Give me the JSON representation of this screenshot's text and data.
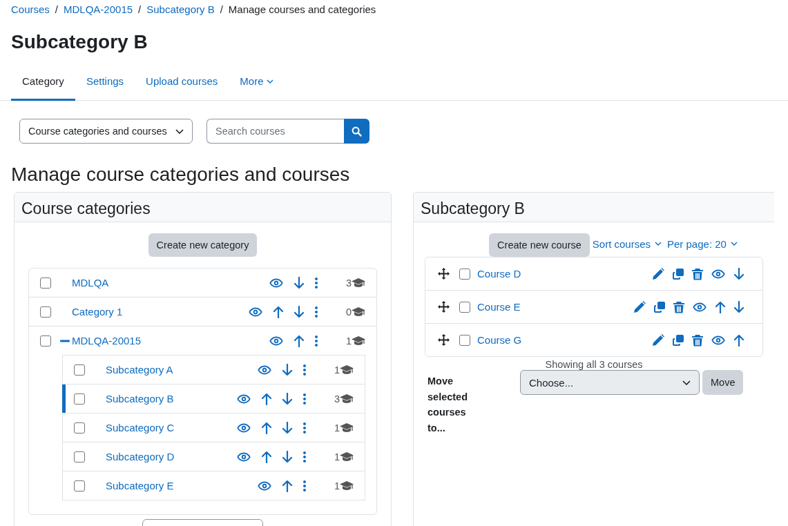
{
  "breadcrumb": [
    {
      "kind": "link",
      "label": "Courses"
    },
    {
      "kind": "separator",
      "label": "/"
    },
    {
      "kind": "link",
      "label": "MDLQA-20015"
    },
    {
      "kind": "separator",
      "label": "/"
    },
    {
      "kind": "link",
      "label": "Subcategory B"
    },
    {
      "kind": "separator",
      "label": "/"
    },
    {
      "kind": "current",
      "label": "Manage courses and categories"
    }
  ],
  "page_title": "Subcategory B",
  "tabs": [
    {
      "label": "Category",
      "selected": true
    },
    {
      "label": "Settings",
      "selected": false
    },
    {
      "label": "Upload courses",
      "selected": false
    },
    {
      "label": "More",
      "selected": false,
      "dropdown": true
    }
  ],
  "view_select": {
    "value": "Course categories and courses"
  },
  "search": {
    "placeholder": "Search courses"
  },
  "heading": "Manage course categories and courses",
  "categories_panel": {
    "title": "Course categories",
    "create_button": "Create new category",
    "categories": [
      {
        "name": "MDLQA",
        "count": "3",
        "checked": false,
        "selected": false,
        "actions": [
          {
            "kind": "eye"
          },
          {
            "kind": "down"
          },
          {
            "kind": "menu"
          }
        ]
      },
      {
        "name": "Category 1",
        "count": "0",
        "checked": false,
        "selected": false,
        "actions": [
          {
            "kind": "eye"
          },
          {
            "kind": "up"
          },
          {
            "kind": "down"
          },
          {
            "kind": "menu"
          }
        ]
      },
      {
        "name": "MDLQA-20015",
        "count": "1",
        "checked": false,
        "selected": false,
        "expanded": true,
        "actions": [
          {
            "kind": "eye"
          },
          {
            "kind": "up"
          },
          {
            "kind": "menu"
          }
        ],
        "children": [
          {
            "name": "Subcategory A",
            "count": "1",
            "checked": false,
            "selected": false,
            "actions": [
              {
                "kind": "eye"
              },
              {
                "kind": "down"
              },
              {
                "kind": "menu"
              }
            ]
          },
          {
            "name": "Subcategory B",
            "count": "3",
            "checked": false,
            "selected": true,
            "actions": [
              {
                "kind": "eye"
              },
              {
                "kind": "up"
              },
              {
                "kind": "down"
              },
              {
                "kind": "menu"
              }
            ]
          },
          {
            "name": "Subcategory C",
            "count": "1",
            "checked": false,
            "selected": false,
            "actions": [
              {
                "kind": "eye"
              },
              {
                "kind": "up"
              },
              {
                "kind": "down"
              },
              {
                "kind": "menu"
              }
            ]
          },
          {
            "name": "Subcategory D",
            "count": "1",
            "checked": false,
            "selected": false,
            "actions": [
              {
                "kind": "eye"
              },
              {
                "kind": "up"
              },
              {
                "kind": "down"
              },
              {
                "kind": "menu"
              }
            ]
          },
          {
            "name": "Subcategory E",
            "count": "1",
            "checked": false,
            "selected": false,
            "actions": [
              {
                "kind": "eye"
              },
              {
                "kind": "up"
              },
              {
                "kind": "menu"
              }
            ]
          }
        ]
      }
    ]
  },
  "courses_panel": {
    "title": "Subcategory B",
    "create_button": "Create new course",
    "sort_link": "Sort courses",
    "per_page_link": "Per page: 20",
    "courses": [
      {
        "name": "Course D",
        "checked": false,
        "actions": [
          {
            "kind": "edit"
          },
          {
            "kind": "copy"
          },
          {
            "kind": "delete"
          },
          {
            "kind": "eye"
          },
          {
            "kind": "down"
          }
        ]
      },
      {
        "name": "Course E",
        "checked": false,
        "actions": [
          {
            "kind": "edit"
          },
          {
            "kind": "copy"
          },
          {
            "kind": "delete"
          },
          {
            "kind": "eye"
          },
          {
            "kind": "up"
          },
          {
            "kind": "down"
          }
        ]
      },
      {
        "name": "Course G",
        "checked": false,
        "actions": [
          {
            "kind": "edit"
          },
          {
            "kind": "copy"
          },
          {
            "kind": "delete"
          },
          {
            "kind": "eye"
          },
          {
            "kind": "up"
          }
        ]
      }
    ],
    "summary": "Showing all 3 courses",
    "move_label": "Move selected courses to...",
    "move_select": {
      "value": "Choose..."
    },
    "move_button": "Move"
  }
}
